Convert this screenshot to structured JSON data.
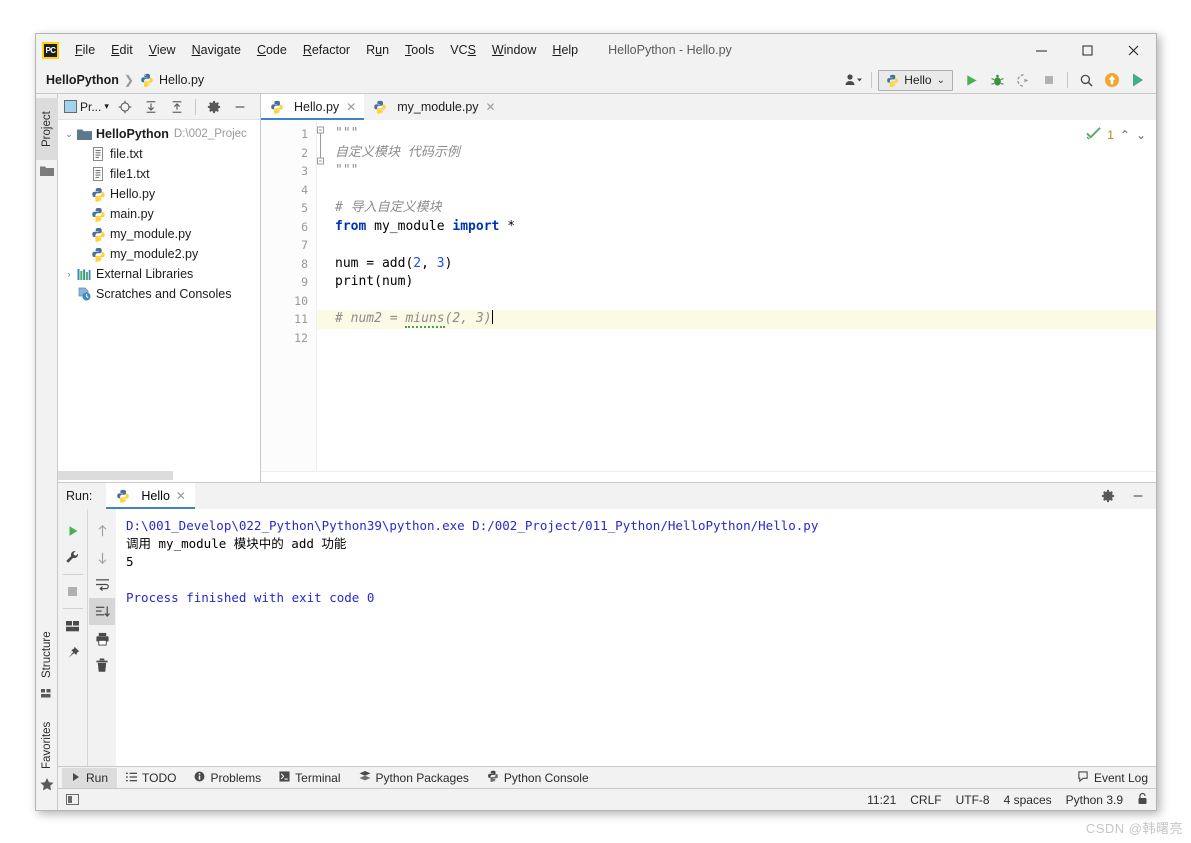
{
  "window": {
    "title": "HelloPython - Hello.py",
    "logo_text": "PC",
    "minimize": "—",
    "maximize": "□",
    "close": "✕"
  },
  "menu": [
    {
      "label": "File",
      "icon": "menu-file"
    },
    {
      "label": "Edit",
      "icon": "menu-edit"
    },
    {
      "label": "View",
      "icon": "menu-view"
    },
    {
      "label": "Navigate",
      "icon": "menu-navigate"
    },
    {
      "label": "Code",
      "icon": "menu-code"
    },
    {
      "label": "Refactor",
      "icon": "menu-refactor"
    },
    {
      "label": "Run",
      "icon": "menu-run"
    },
    {
      "label": "Tools",
      "icon": "menu-tools"
    },
    {
      "label": "VCS",
      "icon": "menu-vcs"
    },
    {
      "label": "Window",
      "icon": "menu-window"
    },
    {
      "label": "Help",
      "icon": "menu-help"
    }
  ],
  "breadcrumb": {
    "project": "HelloPython",
    "separator": "❯",
    "file": "Hello.py"
  },
  "toolbar": {
    "run_config": "Hello",
    "chevron": "⌄",
    "run_tooltip": "Run",
    "debug_tooltip": "Debug",
    "coverage_tooltip": "Run with Coverage",
    "stop_tooltip": "Stop",
    "search_tooltip": "Search Everywhere",
    "update_tooltip": "Update Project",
    "profile_tooltip": "Profile"
  },
  "left_strip": {
    "project": "Project",
    "structure": "Structure",
    "favorites": "Favorites"
  },
  "project_panel": {
    "title": "Pr...",
    "tree": [
      {
        "label": "HelloPython",
        "path": "D:\\002_Projec",
        "icon": "folder-icon",
        "depth": 0,
        "arrow": "⌄",
        "bold": true
      },
      {
        "label": "file.txt",
        "path": "",
        "icon": "txt-file-icon",
        "depth": 1,
        "arrow": "",
        "bold": false
      },
      {
        "label": "file1.txt",
        "path": "",
        "icon": "txt-file-icon",
        "depth": 1,
        "arrow": "",
        "bold": false
      },
      {
        "label": "Hello.py",
        "path": "",
        "icon": "python-file-icon",
        "depth": 1,
        "arrow": "",
        "bold": false
      },
      {
        "label": "main.py",
        "path": "",
        "icon": "python-file-icon",
        "depth": 1,
        "arrow": "",
        "bold": false
      },
      {
        "label": "my_module.py",
        "path": "",
        "icon": "python-file-icon",
        "depth": 1,
        "arrow": "",
        "bold": false
      },
      {
        "label": "my_module2.py",
        "path": "",
        "icon": "python-file-icon",
        "depth": 1,
        "arrow": "",
        "bold": false
      },
      {
        "label": "External Libraries",
        "path": "",
        "icon": "libraries-icon",
        "depth": 0,
        "arrow": "›",
        "bold": false
      },
      {
        "label": "Scratches and Consoles",
        "path": "",
        "icon": "scratches-icon",
        "depth": 0,
        "arrow": "",
        "bold": false
      }
    ]
  },
  "editor": {
    "tabs": [
      {
        "label": "Hello.py",
        "active": true,
        "close": "✕"
      },
      {
        "label": "my_module.py",
        "active": false,
        "close": "✕"
      }
    ],
    "inspection_count": "1",
    "inspection_up": "⌃",
    "inspection_down": "⌄",
    "line_numbers": [
      "1",
      "2",
      "3",
      "4",
      "5",
      "6",
      "7",
      "8",
      "9",
      "10",
      "11",
      "12"
    ],
    "code_lines": [
      {
        "n": 1,
        "text": "\"\"\"",
        "kind": "docstring",
        "highlight": false
      },
      {
        "n": 2,
        "text": "自定义模块 代码示例",
        "kind": "docstring",
        "highlight": false
      },
      {
        "n": 3,
        "text": "\"\"\"",
        "kind": "docstring",
        "highlight": false
      },
      {
        "n": 4,
        "text": "",
        "kind": "plain",
        "highlight": false
      },
      {
        "n": 5,
        "text": "# 导入自定义模块",
        "kind": "comment",
        "highlight": false
      },
      {
        "n": 6,
        "text": "from my_module import *",
        "kind": "import",
        "highlight": false
      },
      {
        "n": 7,
        "text": "",
        "kind": "plain",
        "highlight": false
      },
      {
        "n": 8,
        "text": "num = add(2, 3)",
        "kind": "call",
        "highlight": false
      },
      {
        "n": 9,
        "text": "print(num)",
        "kind": "call",
        "highlight": false
      },
      {
        "n": 10,
        "text": "",
        "kind": "plain",
        "highlight": false
      },
      {
        "n": 11,
        "text": "# num2 = miuns(2, 3)",
        "kind": "comment",
        "highlight": true
      },
      {
        "n": 12,
        "text": "",
        "kind": "plain",
        "highlight": false
      }
    ]
  },
  "run_window": {
    "label": "Run:",
    "tab": "Hello",
    "tab_close": "✕",
    "settings_icon": "gear-icon",
    "minimize_icon": "minimize-icon",
    "console_lines": [
      {
        "text": "D:\\001_Develop\\022_Python\\Python39\\python.exe D:/002_Project/011_Python/HelloPython/Hello.py",
        "color": "blue"
      },
      {
        "text": "调用 my_module 模块中的 add 功能",
        "color": "black"
      },
      {
        "text": "5",
        "color": "black"
      },
      {
        "text": "",
        "color": "black"
      },
      {
        "text": "Process finished with exit code 0",
        "color": "blue"
      }
    ],
    "sidebar_icons_left": [
      "rerun-icon",
      "wrench-icon",
      "stop-icon",
      "layout-icon",
      "pin-icon"
    ],
    "sidebar_icons_right": [
      "up-arrow-icon",
      "down-arrow-icon",
      "soft-wrap-icon",
      "scroll-to-end-icon",
      "print-icon",
      "trash-icon"
    ]
  },
  "bottom_tabs": [
    {
      "label": "Run",
      "icon": "play-icon",
      "active": true
    },
    {
      "label": "TODO",
      "icon": "todo-icon",
      "active": false
    },
    {
      "label": "Problems",
      "icon": "problems-icon",
      "active": false
    },
    {
      "label": "Terminal",
      "icon": "terminal-icon",
      "active": false
    },
    {
      "label": "Python Packages",
      "icon": "packages-icon",
      "active": false
    },
    {
      "label": "Python Console",
      "icon": "python-console-icon",
      "active": false
    }
  ],
  "event_log": {
    "label": "Event Log",
    "icon": "event-log-icon"
  },
  "status_bar": {
    "position": "11:21",
    "line_separator": "CRLF",
    "encoding": "UTF-8",
    "indent": "4 spaces",
    "interpreter": "Python 3.9",
    "lock_icon": "lock-icon",
    "layout_icon": "layout-toggle-icon"
  },
  "watermark": "CSDN @韩曙亮",
  "colors": {
    "accent": "#4083c9",
    "run_green": "#4caf50",
    "keyword_blue": "#0033b3",
    "number_blue": "#1750eb",
    "comment_gray": "#8c8c8c",
    "console_blue": "#2727d0",
    "highlight_line": "#fcfae4"
  }
}
